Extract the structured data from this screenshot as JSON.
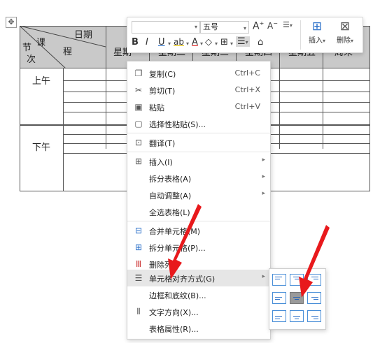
{
  "table": {
    "header_date": "日期",
    "header_lesson": "课",
    "header_section": "节",
    "header_order": "次",
    "header_process": "程",
    "header_weekday1": "星期",
    "header_weekday2": "星期二",
    "header_weekday3": "星期三",
    "header_weekday4": "星期四",
    "header_weekday5": "星期五",
    "header_weekday6": "周末",
    "morning": "上午",
    "afternoon": "下午"
  },
  "mini_toolbar": {
    "font_name": "",
    "font_size": "五号",
    "bold": "B",
    "italic": "I",
    "underline": "U",
    "highlight": "ab",
    "font_color": "A",
    "grow_font": "A",
    "shrink_font": "A",
    "insert_label": "插入",
    "delete_label": "删除"
  },
  "context_menu": {
    "items": [
      {
        "label": "复制(C)",
        "shortcut": "Ctrl+C",
        "icon": "copy-icon"
      },
      {
        "label": "剪切(T)",
        "shortcut": "Ctrl+X",
        "icon": "scissors-icon"
      },
      {
        "label": "粘贴",
        "shortcut": "Ctrl+V",
        "icon": "paste-icon"
      },
      {
        "label": "选择性粘贴(S)...",
        "shortcut": "",
        "icon": "paste-special-icon"
      },
      {
        "label": "翻译(T)",
        "shortcut": "",
        "icon": "translate-icon"
      },
      {
        "label": "插入(I)",
        "shortcut": "",
        "icon": "table-insert-icon"
      },
      {
        "label": "拆分表格(A)",
        "shortcut": "",
        "icon": ""
      },
      {
        "label": "自动调整(A)",
        "shortcut": "",
        "icon": ""
      },
      {
        "label": "全选表格(L)",
        "shortcut": "",
        "icon": ""
      },
      {
        "label": "合并单元格(M)",
        "shortcut": "",
        "icon": "merge-cells-icon"
      },
      {
        "label": "拆分单元格(P)...",
        "shortcut": "",
        "icon": "split-cells-icon"
      },
      {
        "label": "删除列",
        "shortcut": "",
        "icon": "delete-column-icon"
      },
      {
        "label": "单元格对齐方式(G)",
        "shortcut": "",
        "icon": "cell-align-icon"
      },
      {
        "label": "边框和底纹(B)...",
        "shortcut": "",
        "icon": ""
      },
      {
        "label": "文字方向(X)...",
        "shortcut": "",
        "icon": "text-direction-icon"
      },
      {
        "label": "表格属性(R)...",
        "shortcut": "",
        "icon": ""
      }
    ]
  },
  "colors": {
    "accent": "#2a6fc9",
    "header_fill": "#c9c9c9",
    "highlight_row": "#e6e6e6",
    "arrow": "#e8191c"
  }
}
